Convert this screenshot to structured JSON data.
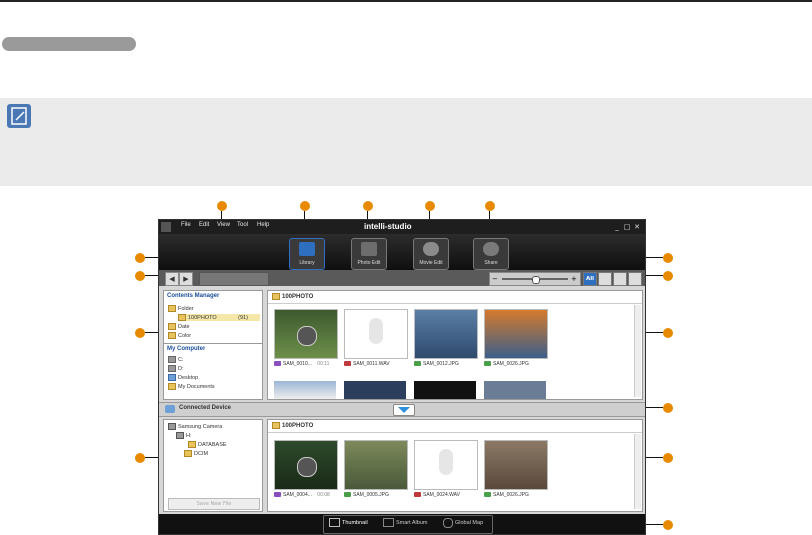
{
  "window": {
    "title": "intelli-studio",
    "menu": [
      "File",
      "Edit",
      "View",
      "Tool",
      "Help"
    ],
    "controls": [
      "_",
      "□",
      "✕"
    ]
  },
  "modes": [
    {
      "label": "Library",
      "icon": "library-icon",
      "color": "#2f6fc0"
    },
    {
      "label": "Photo Edit",
      "icon": "photo-edit-icon",
      "color": "#6d6d6d"
    },
    {
      "label": "Movie Edit",
      "icon": "movie-edit-icon",
      "color": "#8b8b8b"
    },
    {
      "label": "Share",
      "icon": "share-globe-icon",
      "color": "#7a7a7a"
    }
  ],
  "nav": {
    "back": "◀",
    "forward": "▶",
    "zoom_minus": "−",
    "zoom_plus": "+",
    "filter_all": "All"
  },
  "contents_manager": {
    "title": "Contents Manager",
    "items": [
      {
        "label": "Folder",
        "indent": 0
      },
      {
        "label": "100PHOTO",
        "count": "(91)",
        "indent": 1
      },
      {
        "label": "Date",
        "indent": 0
      },
      {
        "label": "Color",
        "indent": 0
      }
    ]
  },
  "my_computer": {
    "title": "My Computer",
    "items": [
      "C:",
      "D:",
      "Desktop",
      "My Documents"
    ]
  },
  "library_panel": {
    "folder": "100PHOTO",
    "files": [
      {
        "name": "SAM_0010...",
        "duration": "00:11",
        "type": "video",
        "badge_color": "#8a4fbf"
      },
      {
        "name": "SAM_0011.WAV",
        "duration": "",
        "type": "audio",
        "badge_color": "#c0393b"
      },
      {
        "name": "SAM_0012.JPG",
        "duration": "",
        "type": "photo",
        "badge_color": "#4aa04a"
      },
      {
        "name": "SAM_0026.JPG",
        "duration": "",
        "type": "photo",
        "badge_color": "#4aa04a"
      }
    ]
  },
  "connected_device": {
    "title": "Connected Device",
    "tree": [
      {
        "label": "Samsung Camera",
        "indent": 0
      },
      {
        "label": "H:",
        "indent": 1
      },
      {
        "label": "DATABASE",
        "indent": 2
      },
      {
        "label": "DCIM",
        "indent": 2
      }
    ],
    "save_button": "Save New File",
    "folder": "100PHOTO",
    "files": [
      {
        "name": "SAM_0004...",
        "duration": "00:08",
        "type": "video",
        "badge_color": "#8a4fbf"
      },
      {
        "name": "SAM_0005.JPG",
        "duration": "",
        "type": "photo",
        "badge_color": "#4aa04a"
      },
      {
        "name": "SAM_0024.WAV",
        "duration": "",
        "type": "audio",
        "badge_color": "#c0393b"
      },
      {
        "name": "SAM_0026.JPG",
        "duration": "",
        "type": "photo",
        "badge_color": "#4aa04a"
      }
    ]
  },
  "footer": {
    "thumbnail": "Thumbnail",
    "smart_album": "Smart Album",
    "global_map": "Global Map"
  },
  "colors": {
    "callout": "#e88a00",
    "accent_blue": "#2f6fc0",
    "dark_bg": "#111111"
  }
}
